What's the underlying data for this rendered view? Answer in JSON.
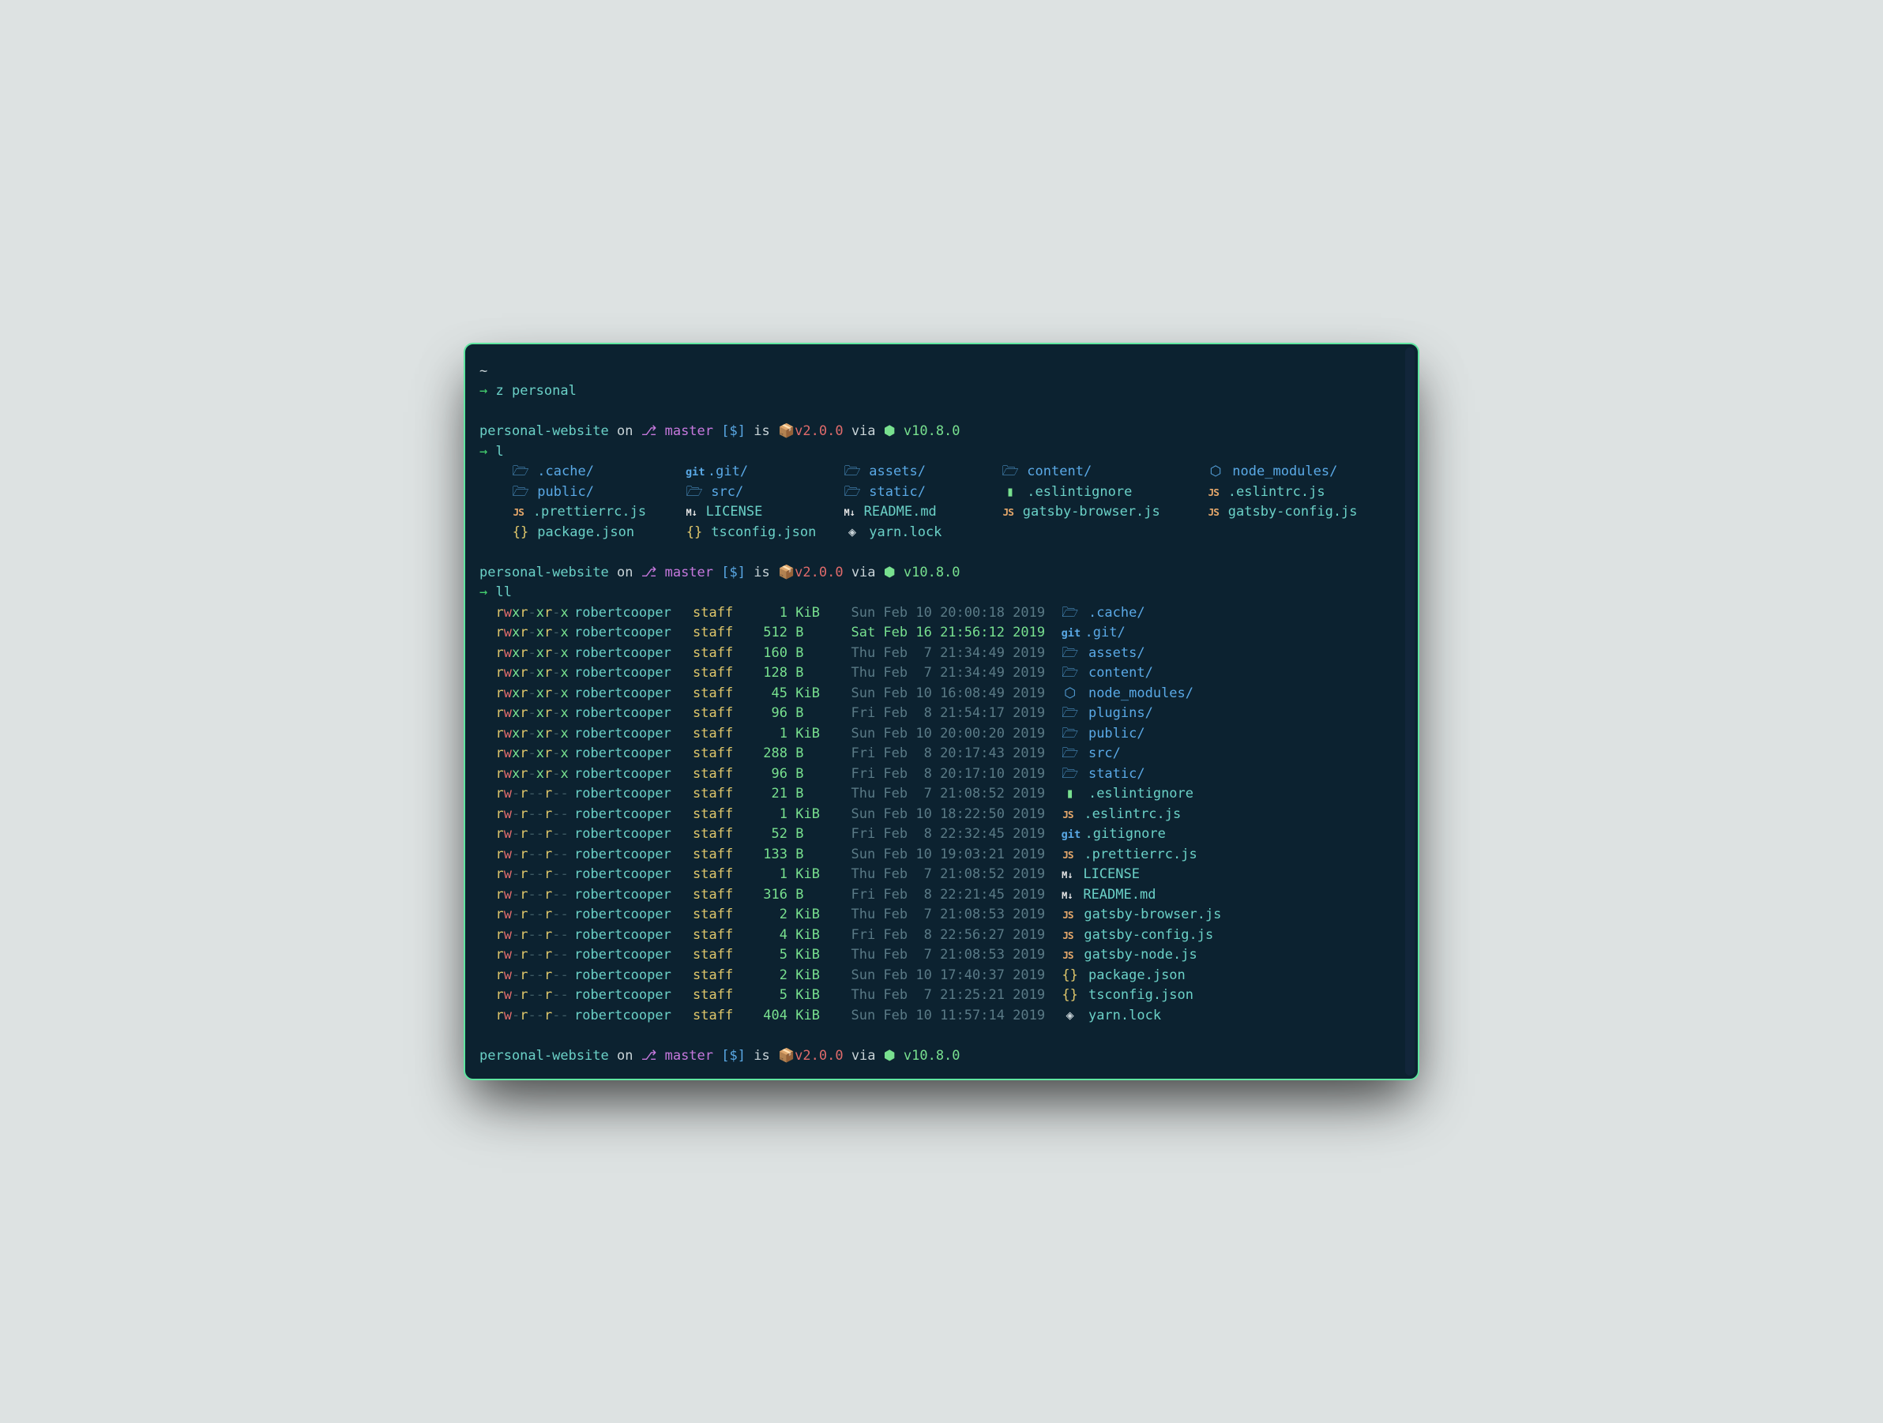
{
  "home_prompt": {
    "tilde": "~",
    "arrow": "→",
    "cmd": "z personal"
  },
  "prompt": {
    "path": "personal-website",
    "on": "on",
    "branch_icon": "⎇",
    "branch": "master",
    "vcs_status": "[$]",
    "is": "is",
    "pkg_icon": "📦",
    "pkg": "v2.0.0",
    "via": "via",
    "node_icon": "⬢",
    "node": "v10.8.0"
  },
  "l_cmd": "l",
  "ll_cmd": "ll",
  "grid_rows": [
    [
      {
        "icon": "folder",
        "name": ".cache/",
        "dir": true
      },
      {
        "icon": "git",
        "name": ".git/",
        "dir": true
      },
      {
        "icon": "folder",
        "name": "assets/",
        "dir": true
      },
      {
        "icon": "folder",
        "name": "content/",
        "dir": true
      },
      {
        "icon": "hex",
        "name": "node_modules/",
        "dir": true
      }
    ],
    [
      {
        "icon": "folder",
        "name": "public/",
        "dir": true
      },
      {
        "icon": "folder",
        "name": "src/",
        "dir": true
      },
      {
        "icon": "folder",
        "name": "static/",
        "dir": true
      },
      {
        "icon": "file",
        "name": ".eslintignore",
        "dir": false
      },
      {
        "icon": "js",
        "name": ".eslintrc.js",
        "dir": false
      }
    ],
    [
      {
        "icon": "js",
        "name": ".prettierrc.js",
        "dir": false
      },
      {
        "icon": "md",
        "name": "LICENSE",
        "dir": false
      },
      {
        "icon": "md",
        "name": "README.md",
        "dir": false
      },
      {
        "icon": "js",
        "name": "gatsby-browser.js",
        "dir": false
      },
      {
        "icon": "js",
        "name": "gatsby-config.js",
        "dir": false
      }
    ],
    [
      {
        "icon": "json",
        "name": "package.json",
        "dir": false
      },
      {
        "icon": "json",
        "name": "tsconfig.json",
        "dir": false
      },
      {
        "icon": "lock",
        "name": "yarn.lock",
        "dir": false
      }
    ]
  ],
  "ll_rows": [
    {
      "perm": "rwxr-xr-x",
      "dir": true,
      "owner": "robertcooper",
      "group": "staff",
      "size": "1",
      "unit": "KiB",
      "date": "Sun Feb 10 20:00:18 2019",
      "mod": false,
      "icon": "folder",
      "name": ".cache/",
      "isdir": true
    },
    {
      "perm": "rwxr-xr-x",
      "dir": true,
      "owner": "robertcooper",
      "group": "staff",
      "size": "512",
      "unit": "B",
      "date": "Sat Feb 16 21:56:12 2019",
      "mod": true,
      "icon": "git",
      "name": ".git/",
      "isdir": true
    },
    {
      "perm": "rwxr-xr-x",
      "dir": true,
      "owner": "robertcooper",
      "group": "staff",
      "size": "160",
      "unit": "B",
      "date": "Thu Feb  7 21:34:49 2019",
      "mod": false,
      "icon": "folder",
      "name": "assets/",
      "isdir": true
    },
    {
      "perm": "rwxr-xr-x",
      "dir": true,
      "owner": "robertcooper",
      "group": "staff",
      "size": "128",
      "unit": "B",
      "date": "Thu Feb  7 21:34:49 2019",
      "mod": false,
      "icon": "folder",
      "name": "content/",
      "isdir": true
    },
    {
      "perm": "rwxr-xr-x",
      "dir": true,
      "owner": "robertcooper",
      "group": "staff",
      "size": "45",
      "unit": "KiB",
      "date": "Sun Feb 10 16:08:49 2019",
      "mod": false,
      "icon": "hex",
      "name": "node_modules/",
      "isdir": true
    },
    {
      "perm": "rwxr-xr-x",
      "dir": true,
      "owner": "robertcooper",
      "group": "staff",
      "size": "96",
      "unit": "B",
      "date": "Fri Feb  8 21:54:17 2019",
      "mod": false,
      "icon": "folder",
      "name": "plugins/",
      "isdir": true
    },
    {
      "perm": "rwxr-xr-x",
      "dir": true,
      "owner": "robertcooper",
      "group": "staff",
      "size": "1",
      "unit": "KiB",
      "date": "Sun Feb 10 20:00:20 2019",
      "mod": false,
      "icon": "folder",
      "name": "public/",
      "isdir": true
    },
    {
      "perm": "rwxr-xr-x",
      "dir": true,
      "owner": "robertcooper",
      "group": "staff",
      "size": "288",
      "unit": "B",
      "date": "Fri Feb  8 20:17:43 2019",
      "mod": false,
      "icon": "folder",
      "name": "src/",
      "isdir": true
    },
    {
      "perm": "rwxr-xr-x",
      "dir": true,
      "owner": "robertcooper",
      "group": "staff",
      "size": "96",
      "unit": "B",
      "date": "Fri Feb  8 20:17:10 2019",
      "mod": false,
      "icon": "folder",
      "name": "static/",
      "isdir": true
    },
    {
      "perm": "rw-r--r--",
      "dir": false,
      "owner": "robertcooper",
      "group": "staff",
      "size": "21",
      "unit": "B",
      "date": "Thu Feb  7 21:08:52 2019",
      "mod": false,
      "icon": "file",
      "name": ".eslintignore",
      "isdir": false
    },
    {
      "perm": "rw-r--r--",
      "dir": false,
      "owner": "robertcooper",
      "group": "staff",
      "size": "1",
      "unit": "KiB",
      "date": "Sun Feb 10 18:22:50 2019",
      "mod": false,
      "icon": "js",
      "name": ".eslintrc.js",
      "isdir": false
    },
    {
      "perm": "rw-r--r--",
      "dir": false,
      "owner": "robertcooper",
      "group": "staff",
      "size": "52",
      "unit": "B",
      "date": "Fri Feb  8 22:32:45 2019",
      "mod": false,
      "icon": "git",
      "name": ".gitignore",
      "isdir": false
    },
    {
      "perm": "rw-r--r--",
      "dir": false,
      "owner": "robertcooper",
      "group": "staff",
      "size": "133",
      "unit": "B",
      "date": "Sun Feb 10 19:03:21 2019",
      "mod": false,
      "icon": "js",
      "name": ".prettierrc.js",
      "isdir": false
    },
    {
      "perm": "rw-r--r--",
      "dir": false,
      "owner": "robertcooper",
      "group": "staff",
      "size": "1",
      "unit": "KiB",
      "date": "Thu Feb  7 21:08:52 2019",
      "mod": false,
      "icon": "md",
      "name": "LICENSE",
      "isdir": false
    },
    {
      "perm": "rw-r--r--",
      "dir": false,
      "owner": "robertcooper",
      "group": "staff",
      "size": "316",
      "unit": "B",
      "date": "Fri Feb  8 22:21:45 2019",
      "mod": false,
      "icon": "md",
      "name": "README.md",
      "isdir": false
    },
    {
      "perm": "rw-r--r--",
      "dir": false,
      "owner": "robertcooper",
      "group": "staff",
      "size": "2",
      "unit": "KiB",
      "date": "Thu Feb  7 21:08:53 2019",
      "mod": false,
      "icon": "js",
      "name": "gatsby-browser.js",
      "isdir": false
    },
    {
      "perm": "rw-r--r--",
      "dir": false,
      "owner": "robertcooper",
      "group": "staff",
      "size": "4",
      "unit": "KiB",
      "date": "Fri Feb  8 22:56:27 2019",
      "mod": false,
      "icon": "js",
      "name": "gatsby-config.js",
      "isdir": false
    },
    {
      "perm": "rw-r--r--",
      "dir": false,
      "owner": "robertcooper",
      "group": "staff",
      "size": "5",
      "unit": "KiB",
      "date": "Thu Feb  7 21:08:53 2019",
      "mod": false,
      "icon": "js",
      "name": "gatsby-node.js",
      "isdir": false
    },
    {
      "perm": "rw-r--r--",
      "dir": false,
      "owner": "robertcooper",
      "group": "staff",
      "size": "2",
      "unit": "KiB",
      "date": "Sun Feb 10 17:40:37 2019",
      "mod": false,
      "icon": "json",
      "name": "package.json",
      "isdir": false
    },
    {
      "perm": "rw-r--r--",
      "dir": false,
      "owner": "robertcooper",
      "group": "staff",
      "size": "5",
      "unit": "KiB",
      "date": "Thu Feb  7 21:25:21 2019",
      "mod": false,
      "icon": "json",
      "name": "tsconfig.json",
      "isdir": false
    },
    {
      "perm": "rw-r--r--",
      "dir": false,
      "owner": "robertcooper",
      "group": "staff",
      "size": "404",
      "unit": "KiB",
      "date": "Sun Feb 10 11:57:14 2019",
      "mod": false,
      "icon": "lock",
      "name": "yarn.lock",
      "isdir": false
    }
  ]
}
